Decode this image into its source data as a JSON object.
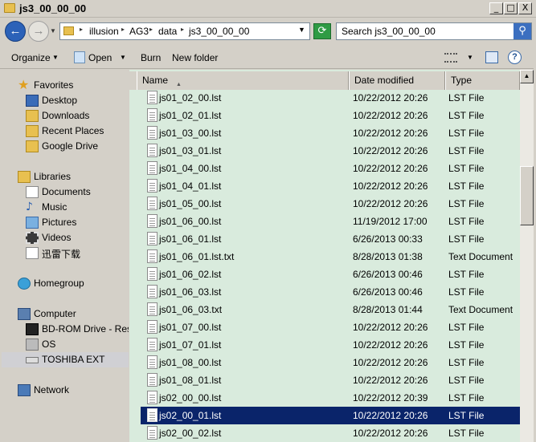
{
  "window": {
    "title": "js3_00_00_00"
  },
  "title_buttons": {
    "minimize": "_",
    "maximize": "□",
    "close": "X"
  },
  "address": {
    "back_glyph": "←",
    "forward_glyph": "→",
    "crumbs": [
      "illusion",
      "AG3",
      "data",
      "js3_00_00_00"
    ],
    "refresh_glyph": "⟳",
    "search_text": "Search js3_00_00_00",
    "search_glyph": "⚲"
  },
  "toolbar": {
    "organize": "Organize",
    "open": "Open",
    "burn": "Burn",
    "new_folder": "New folder",
    "help_glyph": "?"
  },
  "nav": {
    "favorites": "Favorites",
    "desktop": "Desktop",
    "downloads": "Downloads",
    "recent_places": "Recent Places",
    "google_drive": "Google Drive",
    "libraries": "Libraries",
    "documents": "Documents",
    "music": "Music",
    "pictures": "Pictures",
    "videos": "Videos",
    "xunlei": "迅雷下载",
    "homegroup": "Homegroup",
    "computer": "Computer",
    "bdrom": "BD-ROM Drive - Reside",
    "os": "OS",
    "toshiba": "TOSHIBA EXT",
    "network": "Network"
  },
  "columns": {
    "name": "Name",
    "date": "Date modified",
    "type": "Type"
  },
  "files": [
    {
      "name": "js01_02_00.lst",
      "date": "10/22/2012 20:26",
      "type": "LST File"
    },
    {
      "name": "js01_02_01.lst",
      "date": "10/22/2012 20:26",
      "type": "LST File"
    },
    {
      "name": "js01_03_00.lst",
      "date": "10/22/2012 20:26",
      "type": "LST File"
    },
    {
      "name": "js01_03_01.lst",
      "date": "10/22/2012 20:26",
      "type": "LST File"
    },
    {
      "name": "js01_04_00.lst",
      "date": "10/22/2012 20:26",
      "type": "LST File"
    },
    {
      "name": "js01_04_01.lst",
      "date": "10/22/2012 20:26",
      "type": "LST File"
    },
    {
      "name": "js01_05_00.lst",
      "date": "10/22/2012 20:26",
      "type": "LST File"
    },
    {
      "name": "js01_06_00.lst",
      "date": "11/19/2012 17:00",
      "type": "LST File"
    },
    {
      "name": "js01_06_01.lst",
      "date": "6/26/2013 00:33",
      "type": "LST File"
    },
    {
      "name": "js01_06_01.lst.txt",
      "date": "8/28/2013 01:38",
      "type": "Text Document"
    },
    {
      "name": "js01_06_02.lst",
      "date": "6/26/2013 00:46",
      "type": "LST File"
    },
    {
      "name": "js01_06_03.lst",
      "date": "6/26/2013 00:46",
      "type": "LST File"
    },
    {
      "name": "js01_06_03.txt",
      "date": "8/28/2013 01:44",
      "type": "Text Document"
    },
    {
      "name": "js01_07_00.lst",
      "date": "10/22/2012 20:26",
      "type": "LST File"
    },
    {
      "name": "js01_07_01.lst",
      "date": "10/22/2012 20:26",
      "type": "LST File"
    },
    {
      "name": "js01_08_00.lst",
      "date": "10/22/2012 20:26",
      "type": "LST File"
    },
    {
      "name": "js01_08_01.lst",
      "date": "10/22/2012 20:26",
      "type": "LST File"
    },
    {
      "name": "js02_00_00.lst",
      "date": "10/22/2012 20:39",
      "type": "LST File"
    },
    {
      "name": "js02_00_01.lst",
      "date": "10/22/2012 20:26",
      "type": "LST File",
      "selected": true
    },
    {
      "name": "js02_00_02.lst",
      "date": "10/22/2012 20:26",
      "type": "LST File"
    }
  ],
  "colors": {
    "selection": "#0a246a",
    "file_pane_bg": "#d9ebdd",
    "chrome": "#d4d0c8"
  }
}
